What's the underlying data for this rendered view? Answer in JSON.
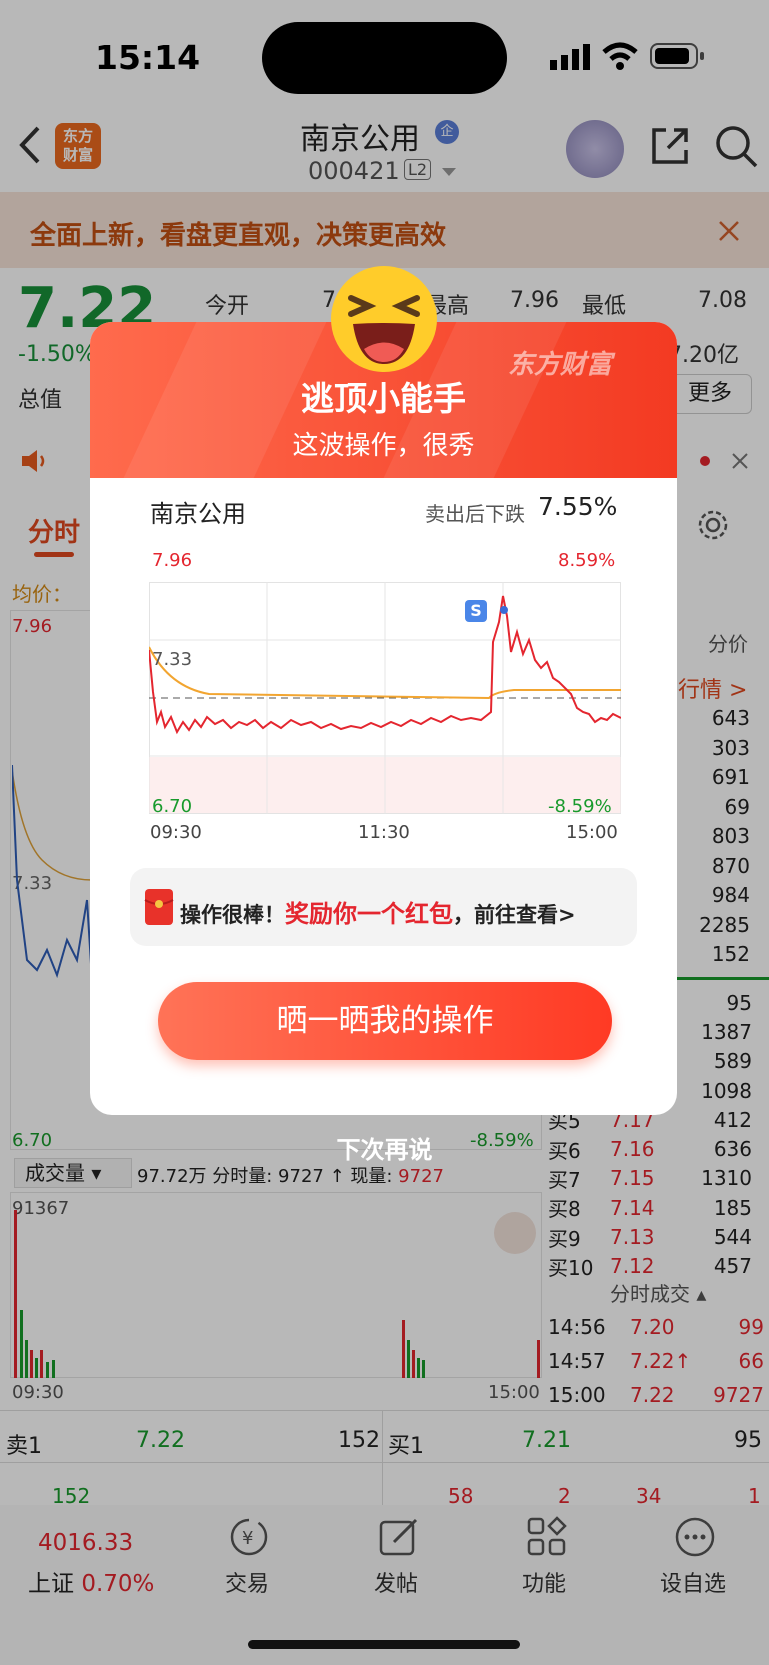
{
  "status": {
    "time": "15:14"
  },
  "header": {
    "title": "南京公用",
    "badge": "企",
    "code": "000421",
    "level": "L2",
    "logo_line1": "东方",
    "logo_line2": "财富"
  },
  "banner": {
    "text": "全面上新，看盘更直观，决策更高效"
  },
  "quote": {
    "price": "7.22",
    "change": "-1.50%",
    "open_label": "今开",
    "open_value": "7.",
    "high_label": "最高",
    "high_value": "7.96",
    "low_label": "最低",
    "low_value": "7.08",
    "mktcap_label": "总值",
    "amount_value": "7.20亿",
    "more_label": "更多"
  },
  "tabs": {
    "intraday": "分时",
    "avg_label": "均价："
  },
  "chart": {
    "max": "7.96",
    "min": "6.70",
    "ref": "7.33",
    "max_pct": "8.59%",
    "min_pct": "-8.59%",
    "right_col_header": "分价",
    "right_col_link": "行情 >"
  },
  "volume": {
    "selector": "成交量",
    "summary_a": "97.72万 分时量: 9727 ↑ 现量: ",
    "summary_b": "9727",
    "max": "91367",
    "t_start": "09:30",
    "t_end": "15:00"
  },
  "depth_right_top": [
    "643",
    "303",
    "691",
    "69",
    "803",
    "870",
    "984",
    "2285",
    "152"
  ],
  "bids": [
    {
      "label": "",
      "price": "",
      "vol": "95"
    },
    {
      "label": "",
      "price": "",
      "vol": "1387"
    },
    {
      "label": "",
      "price": "",
      "vol": "589"
    },
    {
      "label": "",
      "price": "",
      "vol": "1098"
    },
    {
      "label": "买5",
      "price": "7.17",
      "vol": "412"
    },
    {
      "label": "买6",
      "price": "7.16",
      "vol": "636"
    },
    {
      "label": "买7",
      "price": "7.15",
      "vol": "1310"
    },
    {
      "label": "买8",
      "price": "7.14",
      "vol": "185"
    },
    {
      "label": "买9",
      "price": "7.13",
      "vol": "544"
    },
    {
      "label": "买10",
      "price": "7.12",
      "vol": "457"
    }
  ],
  "trades": {
    "header": "分时成交",
    "rows": [
      {
        "time": "14:56",
        "price": "7.20",
        "vol": "99"
      },
      {
        "time": "14:57",
        "price": "7.22↑",
        "vol": "66"
      },
      {
        "time": "15:00",
        "price": "7.22",
        "vol": "9727"
      }
    ]
  },
  "book": {
    "sell1_label": "卖1",
    "sell1_price": "7.22",
    "sell1_vol": "152",
    "buy1_label": "买1",
    "buy1_price": "7.21",
    "buy1_vol": "95",
    "row2": [
      "152",
      "58",
      "2",
      "34",
      "1"
    ]
  },
  "bottom": {
    "index_value": "4016.33",
    "index_name": "上证",
    "index_change": "0.70%",
    "nav": [
      "交易",
      "发帖",
      "功能",
      "设自选"
    ]
  },
  "modal": {
    "brand": "东方财富",
    "title": "逃顶小能手",
    "subtitle": "这波操作，很秀",
    "stock": "南京公用",
    "drop_label": "卖出后下跌",
    "drop_value": "7.55%",
    "chart_max": "7.96",
    "chart_min": "6.70",
    "chart_ref": "7.33",
    "chart_max_pct": "8.59%",
    "chart_min_pct": "-8.59%",
    "x_start": "09:30",
    "x_mid": "11:30",
    "x_end": "15:00",
    "sell_marker": "S",
    "reward_a": "操作很棒！",
    "reward_b": "奖励你一个红包",
    "reward_c": "，前往查看>",
    "share_button": "晒一晒我的操作",
    "later": "下次再说"
  }
}
